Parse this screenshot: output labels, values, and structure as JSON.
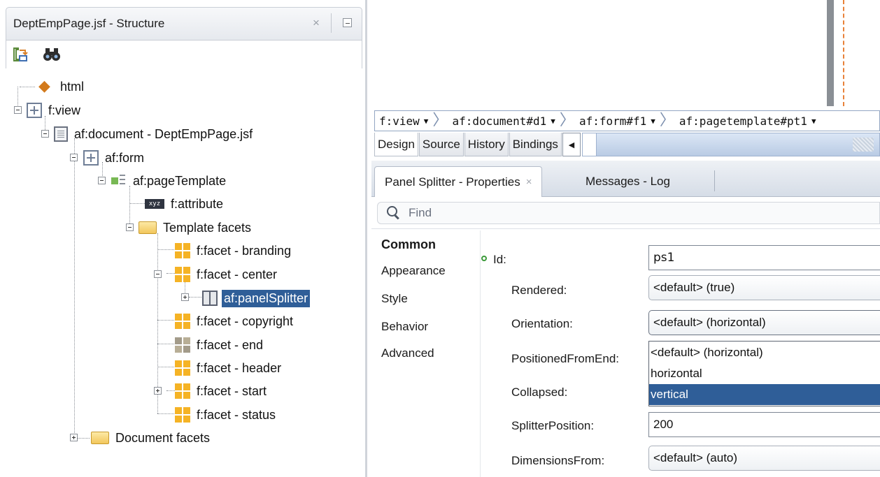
{
  "structure": {
    "title": "DeptEmpPage.jsf - Structure",
    "close_glyph": "×",
    "toolbar": [
      {
        "icon": "sync-icon"
      },
      {
        "icon": "binoculars-icon"
      }
    ],
    "tree": [
      {
        "label": "html",
        "icon": "html-tag-icon"
      },
      {
        "label": "f:view",
        "icon": "grid-icon"
      },
      {
        "label": "af:document - DeptEmpPage.jsf",
        "icon": "document-icon"
      },
      {
        "label": "af:form",
        "icon": "grid-icon"
      },
      {
        "label": "af:pageTemplate",
        "icon": "page-template-icon"
      },
      {
        "label": "f:attribute",
        "icon": "attribute-icon"
      },
      {
        "label": "Template facets",
        "icon": "folder-icon"
      },
      {
        "label": "f:facet - branding",
        "icon": "facet-icon"
      },
      {
        "label": "f:facet - center",
        "icon": "facet-icon"
      },
      {
        "label": "af:panelSplitter",
        "icon": "panel-splitter-icon",
        "selected": true
      },
      {
        "label": "f:facet - copyright",
        "icon": "facet-icon"
      },
      {
        "label": "f:facet - end",
        "icon": "facet-empty-icon"
      },
      {
        "label": "f:facet - header",
        "icon": "facet-icon"
      },
      {
        "label": "f:facet - start",
        "icon": "facet-icon"
      },
      {
        "label": "f:facet - status",
        "icon": "facet-icon"
      },
      {
        "label": "Document facets",
        "icon": "folder-icon"
      }
    ]
  },
  "editor": {
    "breadcrumb": [
      {
        "label": "f:view"
      },
      {
        "label": "af:document#d1"
      },
      {
        "label": "af:form#f1"
      },
      {
        "label": "af:pagetemplate#pt1"
      }
    ],
    "tabs": [
      {
        "label": "Design",
        "active": true
      },
      {
        "label": "Source"
      },
      {
        "label": "History"
      },
      {
        "label": "Bindings"
      }
    ]
  },
  "properties_panel": {
    "tabs": {
      "properties": "Panel Splitter - Properties",
      "close_glyph": "×",
      "messages": "Messages - Log"
    },
    "find_placeholder": "Find",
    "categories": [
      "Common",
      "Appearance",
      "Style",
      "Behavior",
      "Advanced"
    ],
    "properties": [
      {
        "label": "Id:",
        "value": "ps1",
        "kind": "text"
      },
      {
        "label": "Rendered:",
        "value": "<default> (true)",
        "kind": "select"
      },
      {
        "label": "Orientation:",
        "value": "<default> (horizontal)",
        "kind": "select"
      },
      {
        "label": "PositionedFromEnd:",
        "value": "",
        "kind": "hidden"
      },
      {
        "label": "Collapsed:",
        "value": "",
        "kind": "hidden"
      },
      {
        "label": "SplitterPosition:",
        "value": "200",
        "kind": "text"
      },
      {
        "label": "DimensionsFrom:",
        "value": "<default> (auto)",
        "kind": "select"
      }
    ],
    "orientation_options": [
      "<default> (horizontal)",
      "horizontal",
      "vertical"
    ],
    "orientation_highlighted": "vertical"
  },
  "colors": {
    "selection": "#2f5e98",
    "canvas_border_accent": "#e8823a"
  }
}
